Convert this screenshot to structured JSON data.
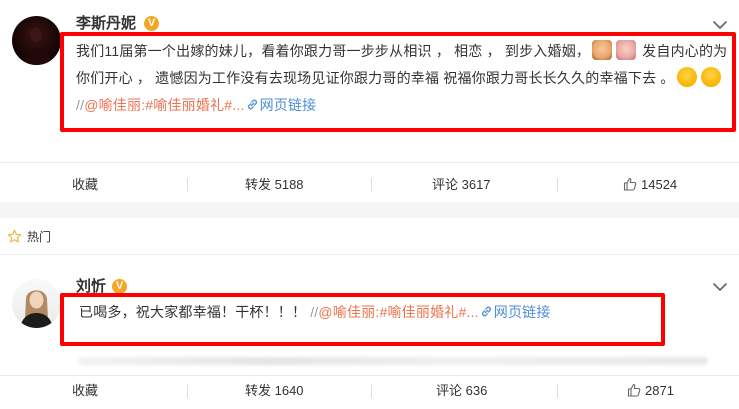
{
  "post1": {
    "author": "李斯丹妮",
    "verified_badge": "V",
    "text_before_emoji": "我们11届第一个出嫁的妹儿，看着你跟力哥一步步从相识 ， 相恋 ， 到步入婚姻，",
    "text_after_emoji": " 发自内心的为你们开心 ， 遗憾因为工作没有去现场见证你跟力哥的幸福 祝福你跟力哥长长久久的幸福下去 。",
    "repost_prefix": "//",
    "mention": "@喻佳丽",
    "colon": ":",
    "hashtag": "#喻佳丽婚礼#",
    "ellipsis": "...",
    "link_label": "网页链接",
    "actions": {
      "favorite": "收藏",
      "repost": "转发 5188",
      "comment": "评论 3617",
      "like": "14524"
    }
  },
  "hot_section": {
    "label": "热门"
  },
  "post2": {
    "author": "刘忻",
    "verified_badge": "V",
    "text": "已喝多，祝大家都幸福！干杯！！！",
    "repost_prefix": "//",
    "mention": "@喻佳丽",
    "colon": ":",
    "hashtag": "#喻佳丽婚礼#",
    "ellipsis": "...",
    "link_label": "网页链接",
    "actions": {
      "favorite": "收藏",
      "repost": "转发 1640",
      "comment": "评论 636",
      "like": "2871"
    }
  },
  "icons": {
    "verified": "verified-badge-icon",
    "menu": "chevron-down-icon",
    "hot": "star-icon",
    "like": "thumbs-up-icon",
    "link": "link-icon"
  },
  "colors": {
    "highlight_box": "#ff0000",
    "mention_link": "#eb7350",
    "web_link": "#4e8ed8",
    "verified_badge": "#f5a623"
  }
}
